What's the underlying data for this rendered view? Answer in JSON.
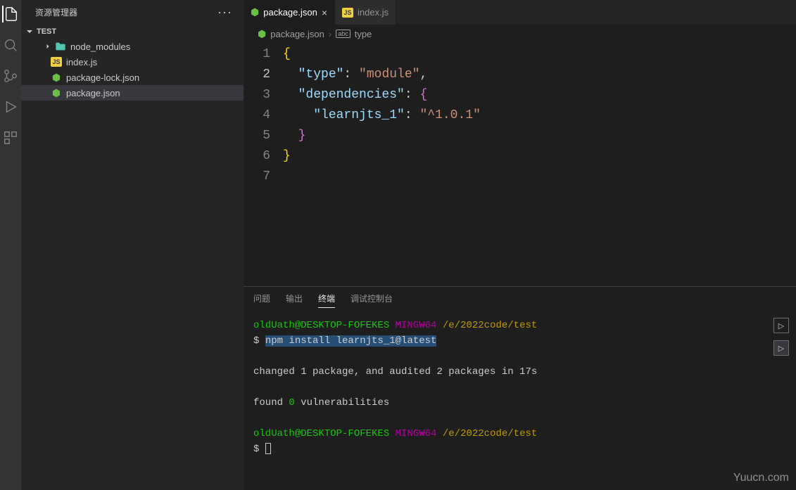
{
  "sidebar": {
    "title": "资源管理器",
    "root": "TEST",
    "items": [
      {
        "name": "node_modules",
        "type": "folder"
      },
      {
        "name": "index.js",
        "type": "js"
      },
      {
        "name": "package-lock.json",
        "type": "node"
      },
      {
        "name": "package.json",
        "type": "node",
        "selected": true
      }
    ]
  },
  "tabs": [
    {
      "label": "package.json",
      "icon": "node",
      "active": true,
      "close": "×"
    },
    {
      "label": "index.js",
      "icon": "js",
      "active": false
    }
  ],
  "breadcrumb": {
    "file": "package.json",
    "symbol": "type",
    "symbol_badge": "abc"
  },
  "code": {
    "lines": [
      "1",
      "2",
      "3",
      "4",
      "5",
      "6",
      "7"
    ],
    "active_line": 2,
    "tokens": {
      "l1": "{",
      "l2_key": "\"type\"",
      "l2_val": "\"module\"",
      "l3_key": "\"dependencies\"",
      "l4_key": "\"learnjts_1\"",
      "l4_val": "\"^1.0.1\"",
      "l5": "}",
      "l6": "}"
    }
  },
  "terminal": {
    "tabs": {
      "problems": "问题",
      "output": "输出",
      "terminal": "终端",
      "debug": "调试控制台"
    },
    "user": "oldUath@DESKTOP-FOFEKES",
    "shell": "MINGW64",
    "cwd": "/e/2022code/test",
    "prompt": "$",
    "command": "npm install learnjts_1@latest",
    "out1": "changed 1 package, and audited 2 packages in 17s",
    "out2_pre": "found ",
    "out2_num": "0",
    "out2_suf": " vulnerabilities"
  },
  "watermark": "Yuucn.com"
}
